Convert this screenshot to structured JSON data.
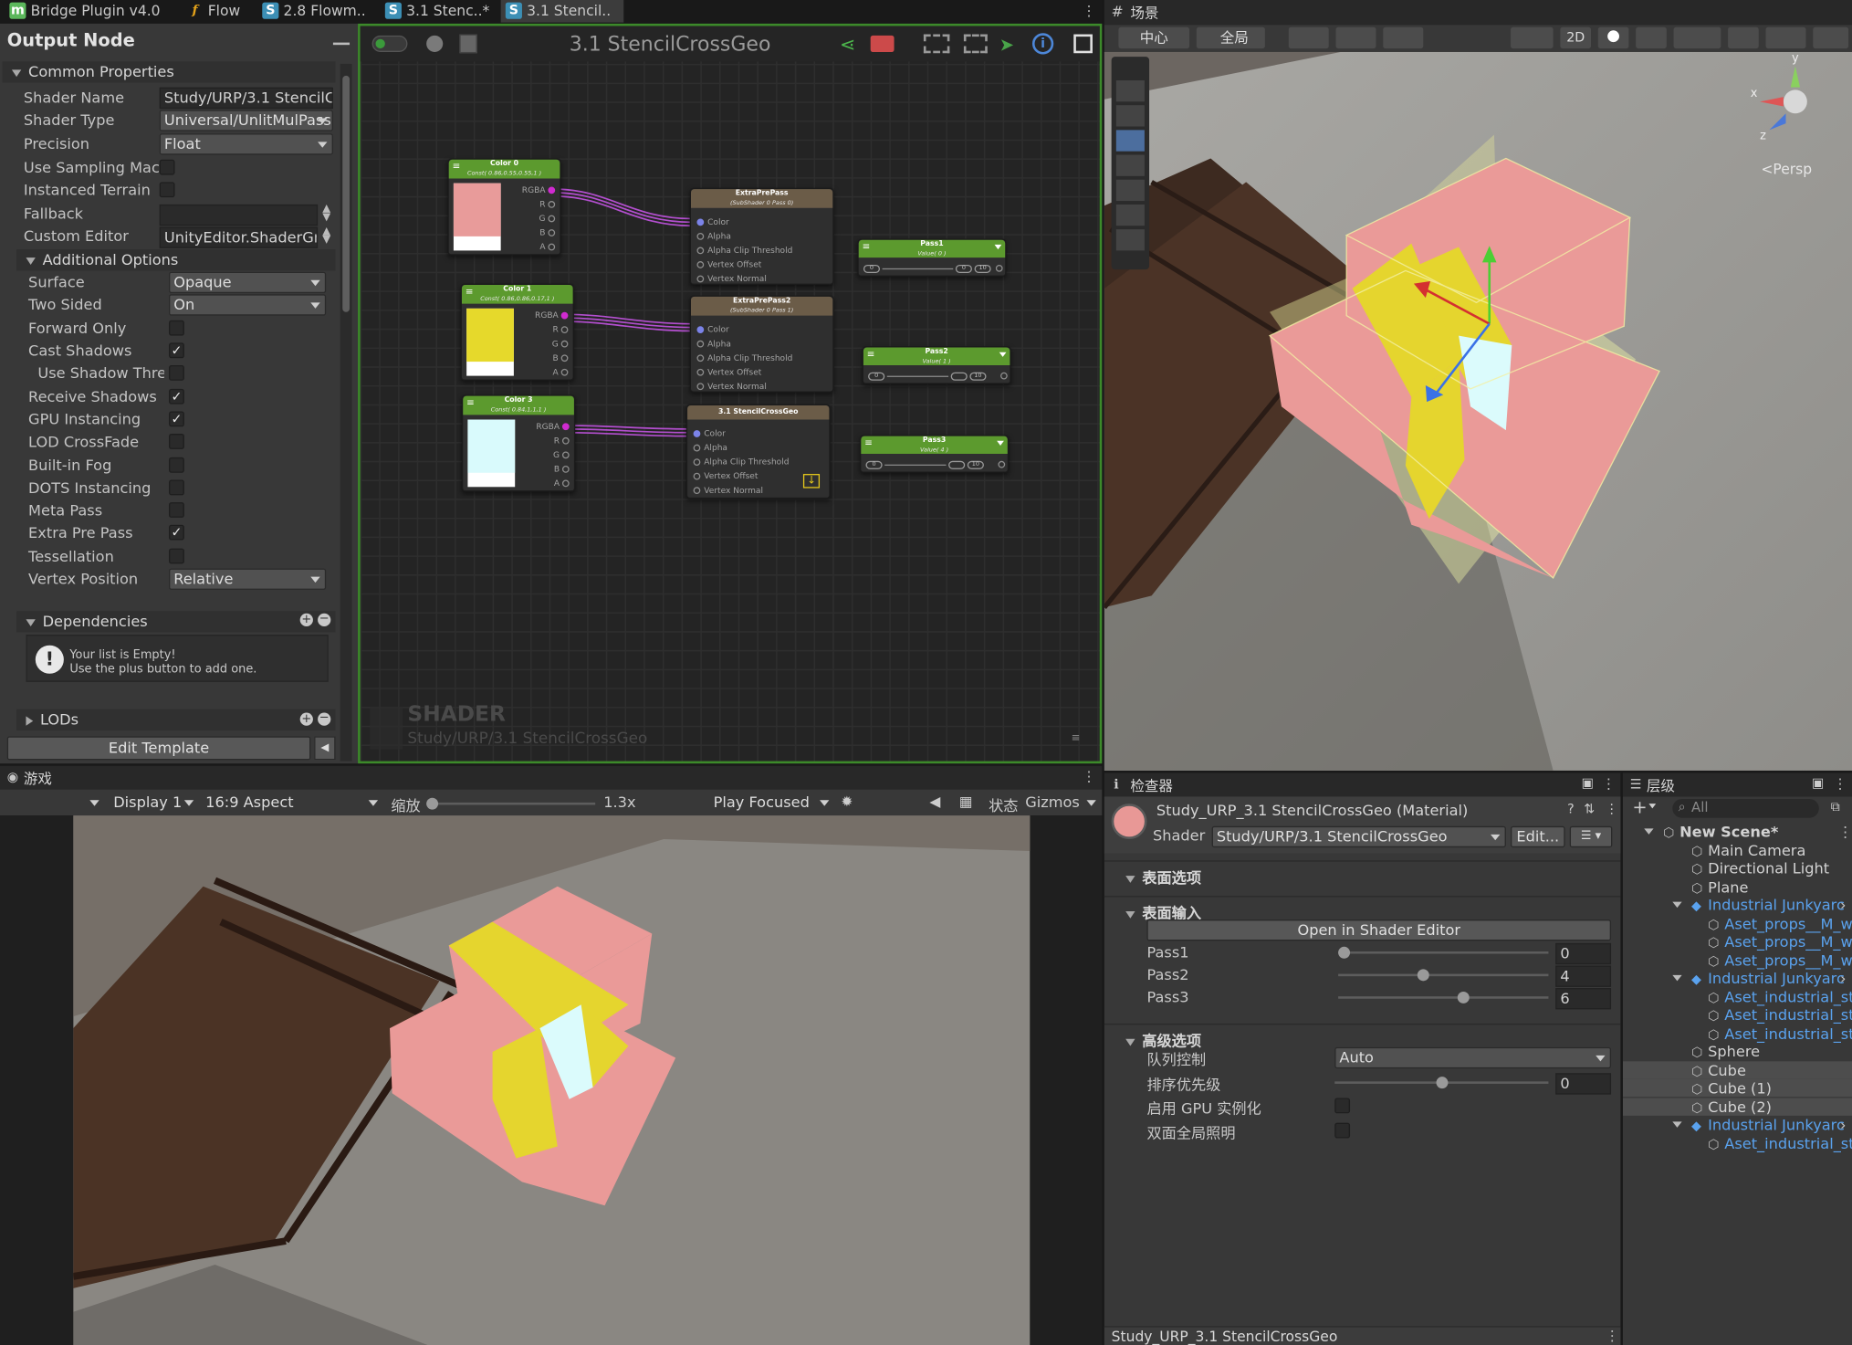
{
  "top_tabs": [
    {
      "label": "Bridge Plugin v4.0",
      "icon": "unity-m-icon"
    },
    {
      "label": "Flow",
      "icon": "function-icon"
    },
    {
      "label": "2.8 Flowm..",
      "icon": "shader-s-icon"
    },
    {
      "label": "3.1 Stenc..*",
      "icon": "shader-s-icon"
    },
    {
      "label": "3.1 Stencil..",
      "icon": "shader-s-icon"
    }
  ],
  "output_node": {
    "title": "Output Node",
    "common_properties": "Common Properties",
    "shader_name_label": "Shader Name",
    "shader_name_value": "Study/URP/3.1 StencilCro",
    "shader_type_label": "Shader Type",
    "shader_type_value": "Universal/UnlitMulPass",
    "precision_label": "Precision",
    "precision_value": "Float",
    "use_sampling_label": "Use Sampling Macr",
    "instanced_terrain_label": "Instanced Terrain",
    "fallback_label": "Fallback",
    "custom_editor_label": "Custom Editor",
    "custom_editor_value": "UnityEditor.ShaderGra",
    "additional_options": "Additional Options",
    "surface_label": "Surface",
    "surface_value": "Opaque",
    "two_sided_label": "Two Sided",
    "two_sided_value": "On",
    "forward_only": "Forward Only",
    "cast_shadows": "Cast Shadows",
    "use_shadow": "Use Shadow Thres",
    "receive_shadows": "Receive Shadows",
    "gpu_instancing": "GPU Instancing",
    "lod_crossfade": "LOD CrossFade",
    "builtin_fog": "Built-in Fog",
    "dots_instancing": "DOTS Instancing",
    "meta_pass": "Meta Pass",
    "extra_pre_pass": "Extra Pre Pass",
    "tessellation": "Tessellation",
    "vertex_position_label": "Vertex Position",
    "vertex_position_value": "Relative",
    "dependencies": "Dependencies",
    "empty_title": "Your list is Empty!",
    "empty_sub": "Use the plus button to add one.",
    "lods": "LODs",
    "edit_template": "Edit Template",
    "check": "✓"
  },
  "graph": {
    "title": "3.1 StencilCrossGeo",
    "watermark_title": "SHADER",
    "watermark_sub": "Study/URP/3.1 StencilCrossGeo",
    "color_nodes": [
      {
        "title": "Color 0",
        "sub": "Const( 0.86,0.55,0.55,1 )",
        "swatch": "#e89b9a"
      },
      {
        "title": "Color 1",
        "sub": "Const( 0.86,0.86,0.17,1 )",
        "swatch": "#e6d92b"
      },
      {
        "title": "Color 3",
        "sub": "Const( 0.84,1,1,1 )",
        "swatch": "#d9fafc"
      }
    ],
    "channels": [
      "RGBA",
      "R",
      "G",
      "B",
      "A"
    ],
    "pass_nodes": [
      {
        "title": "ExtraPrePass",
        "sub": "(SubShader 0 Pass 0)"
      },
      {
        "title": "ExtraPrePass2",
        "sub": "(SubShader 0 Pass 1)"
      },
      {
        "title": "3.1 StencilCrossGeo",
        "sub": ""
      }
    ],
    "inputs": [
      "Color",
      "Alpha",
      "Alpha Clip Threshold",
      "Vertex Offset",
      "Vertex Normal"
    ],
    "int_nodes": [
      {
        "title": "Pass1",
        "sub": "Value( 0 )",
        "min": "0",
        "max": "10"
      },
      {
        "title": "Pass2",
        "sub": "Value( 1 )",
        "min": "0",
        "max": "10"
      },
      {
        "title": "Pass3",
        "sub": "Value( 4 )",
        "min": "0",
        "max": "10"
      }
    ]
  },
  "scene": {
    "tab": "场景",
    "center": "中心",
    "global": "全局",
    "mode_2d": "2D",
    "persp": "Persp",
    "axis_x": "x",
    "axis_y": "y",
    "axis_z": "z"
  },
  "game": {
    "tab": "游戏",
    "display": "Display 1",
    "aspect": "16:9 Aspect",
    "scale_label": "缩放",
    "scale_value": "1.3x",
    "play_focused": "Play Focused",
    "stats": "状态",
    "gizmos": "Gizmos"
  },
  "inspector": {
    "tab": "检查器",
    "material_name": "Study_URP_3.1 StencilCrossGeo (Material)",
    "shader_label": "Shader",
    "shader_value": "Study/URP/3.1 StencilCrossGeo",
    "edit_btn": "Edit...",
    "surface_options": "表面选项",
    "surface_inputs": "表面输入",
    "open_editor": "Open in Shader Editor",
    "pass1_label": "Pass1",
    "pass1_value": "0",
    "pass1_level": 0.0,
    "pass2_label": "Pass2",
    "pass2_value": "4",
    "pass2_level": 0.4,
    "pass3_label": "Pass3",
    "pass3_value": "6",
    "pass3_level": 0.6,
    "advanced": "高级选项",
    "queue_label": "队列控制",
    "queue_value": "Auto",
    "priority_label": "排序优先级",
    "priority_value": "0",
    "priority_level": 0.5,
    "gpu_label": "启用 GPU 实例化",
    "double_gi_label": "双面全局照明",
    "footer": "Study_URP_3.1 StencilCrossGeo",
    "material_color": "#e89896"
  },
  "hierarchy": {
    "tab": "层级",
    "search_placeholder": "All",
    "items": [
      {
        "label": "New Scene*",
        "bold": true,
        "blue": false,
        "indent": 0
      },
      {
        "label": "Main Camera",
        "blue": false,
        "indent": 1
      },
      {
        "label": "Directional Light",
        "blue": false,
        "indent": 1
      },
      {
        "label": "Plane",
        "blue": false,
        "indent": 1
      },
      {
        "label": "Industrial Junkyarc",
        "blue": true,
        "indent": 1
      },
      {
        "label": "Aset_props__M_wd",
        "blue": true,
        "indent": 2
      },
      {
        "label": "Aset_props__M_wd",
        "blue": true,
        "indent": 2
      },
      {
        "label": "Aset_props__M_wd",
        "blue": true,
        "indent": 2
      },
      {
        "label": "Industrial Junkyarc",
        "blue": true,
        "indent": 1
      },
      {
        "label": "Aset_industrial_sto",
        "blue": true,
        "indent": 2
      },
      {
        "label": "Aset_industrial_sto",
        "blue": true,
        "indent": 2
      },
      {
        "label": "Aset_industrial_sto",
        "blue": true,
        "indent": 2
      },
      {
        "label": "Sphere",
        "blue": false,
        "indent": 1
      },
      {
        "label": "Cube",
        "blue": false,
        "indent": 1
      },
      {
        "label": "Cube (1)",
        "blue": false,
        "indent": 1
      },
      {
        "label": "Cube (2)",
        "blue": false,
        "indent": 1
      },
      {
        "label": "Industrial Junkyarc",
        "blue": true,
        "indent": 1
      },
      {
        "label": "Aset_industrial_sto",
        "blue": true,
        "indent": 2
      }
    ]
  },
  "colors": {
    "pink": "#eb9797",
    "yellow": "#e5d52e",
    "cyan": "#dbfbfc",
    "accent_green": "#5fa02f"
  }
}
